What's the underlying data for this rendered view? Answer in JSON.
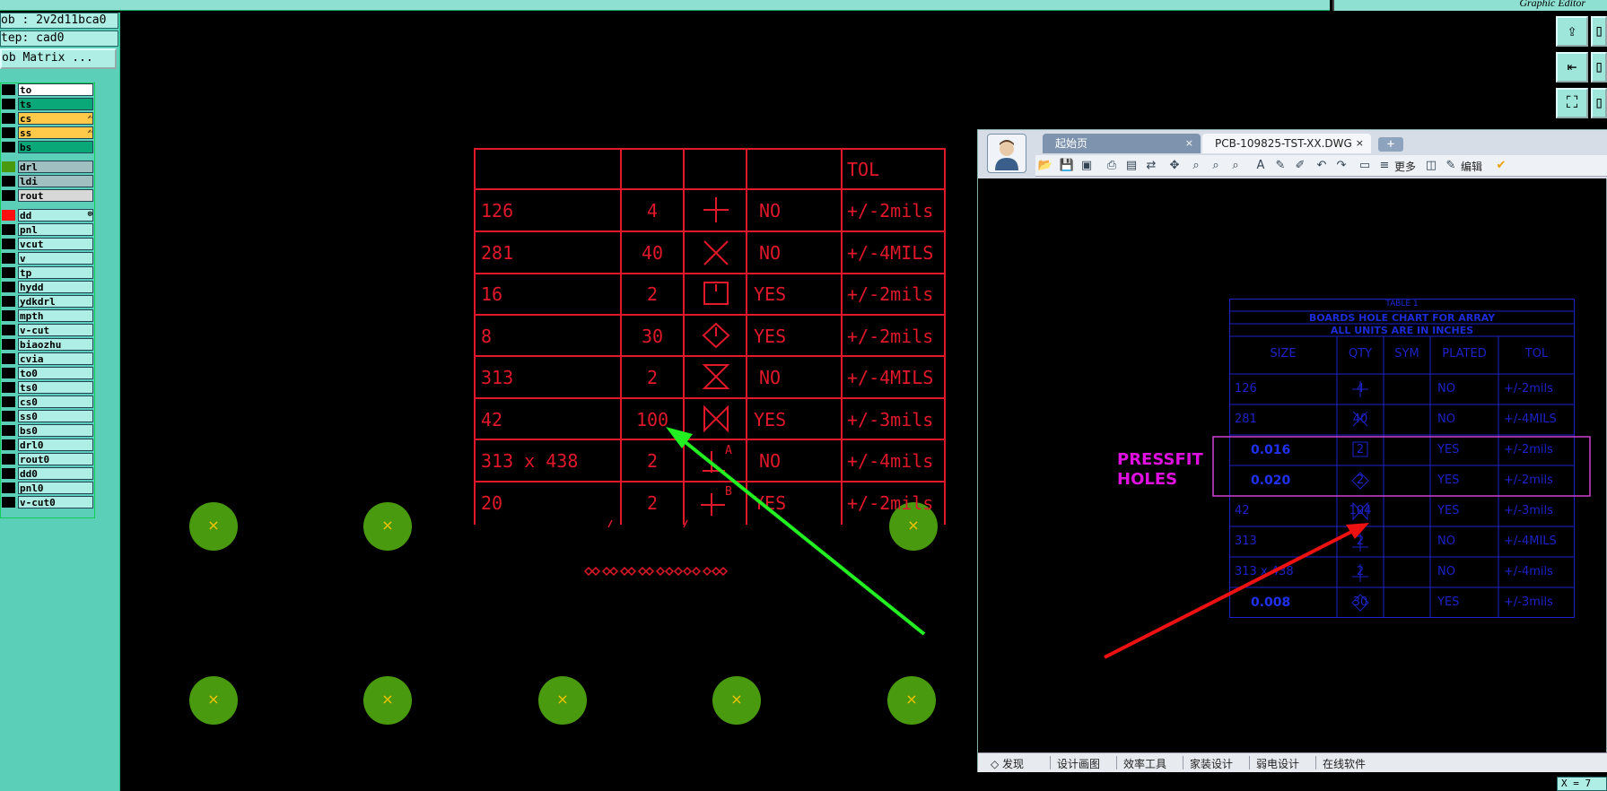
{
  "window": {
    "title": "Graphic Editor"
  },
  "info": {
    "job": "ob : 2v2d11bca0",
    "step": "tep: cad0",
    "matrix_button": "ob Matrix ..."
  },
  "layers": [
    {
      "name": "to",
      "color": "#ffffff",
      "swatch": "#000000"
    },
    {
      "name": "ts",
      "color": "#0aa878",
      "swatch": "#000000"
    },
    {
      "name": "cs",
      "color": "#ffc94a",
      "swatch": "#000000",
      "mark": "✍"
    },
    {
      "name": "ss",
      "color": "#ffc94a",
      "swatch": "#000000",
      "mark": "✍"
    },
    {
      "name": "bs",
      "color": "#0aa878",
      "swatch": "#000000"
    },
    {
      "name": "drl",
      "color": "#9fbfc0",
      "swatch": "#4a9a10"
    },
    {
      "name": "ldi",
      "color": "#9fbfc0",
      "swatch": "#000000"
    },
    {
      "name": "rout",
      "color": "#d8d8d8",
      "swatch": "#000000"
    },
    {
      "name": "dd",
      "color": "#aeeee4",
      "swatch": "#ff1010",
      "mark": "⊗"
    },
    {
      "name": "pnl",
      "color": "#aeeee4",
      "swatch": "#000000"
    },
    {
      "name": "vcut",
      "color": "#aeeee4",
      "swatch": "#000000"
    },
    {
      "name": "v",
      "color": "#aeeee4",
      "swatch": "#000000"
    },
    {
      "name": "tp",
      "color": "#aeeee4",
      "swatch": "#000000"
    },
    {
      "name": "hydd",
      "color": "#aeeee4",
      "swatch": "#000000"
    },
    {
      "name": "ydkdrl",
      "color": "#aeeee4",
      "swatch": "#000000"
    },
    {
      "name": "mpth",
      "color": "#aeeee4",
      "swatch": "#000000"
    },
    {
      "name": "v-cut",
      "color": "#aeeee4",
      "swatch": "#000000"
    },
    {
      "name": "biaozhu",
      "color": "#aeeee4",
      "swatch": "#000000"
    },
    {
      "name": "cvia",
      "color": "#aeeee4",
      "swatch": "#000000"
    },
    {
      "name": "to0",
      "color": "#aeeee4",
      "swatch": "#000000"
    },
    {
      "name": "ts0",
      "color": "#aeeee4",
      "swatch": "#000000"
    },
    {
      "name": "cs0",
      "color": "#aeeee4",
      "swatch": "#000000"
    },
    {
      "name": "ss0",
      "color": "#aeeee4",
      "swatch": "#000000"
    },
    {
      "name": "bs0",
      "color": "#aeeee4",
      "swatch": "#000000"
    },
    {
      "name": "drl0",
      "color": "#aeeee4",
      "swatch": "#000000"
    },
    {
      "name": "rout0",
      "color": "#aeeee4",
      "swatch": "#000000"
    },
    {
      "name": "dd0",
      "color": "#aeeee4",
      "swatch": "#000000"
    },
    {
      "name": "pnl0",
      "color": "#aeeee4",
      "swatch": "#000000"
    },
    {
      "name": "v-cut0",
      "color": "#aeeee4",
      "swatch": "#000000"
    }
  ],
  "red_table": {
    "header_tol": "TOL",
    "rows": [
      {
        "size": "126",
        "qty": "4",
        "plated": "NO",
        "tol": "+/-2mils"
      },
      {
        "size": "281",
        "qty": "40",
        "plated": "NO",
        "tol": "+/-4MILS"
      },
      {
        "size": "16",
        "qty": "2",
        "plated": "YES",
        "tol": "+/-2mils"
      },
      {
        "size": "8",
        "qty": "30",
        "plated": "YES",
        "tol": "+/-2mils"
      },
      {
        "size": "313",
        "qty": "2",
        "plated": "NO",
        "tol": "+/-4MILS"
      },
      {
        "size": "42",
        "qty": "100",
        "plated": "YES",
        "tol": "+/-3mils"
      },
      {
        "size": "313 x 438",
        "qty": "2",
        "plated": "NO",
        "tol": "+/-4mils"
      },
      {
        "size": "20",
        "qty": "2",
        "plated": "YES",
        "tol": "+/-2mils"
      }
    ],
    "sym_labels": {
      "a": "A",
      "b": "B"
    }
  },
  "cad_viewer": {
    "tab_home": "起始页",
    "tab_file": "PCB-109825-TST-XX.DWG",
    "tab_close": "×",
    "tab_add": "+",
    "toolbar_more": "更多",
    "toolbar_edit": "编辑",
    "bottom_items": [
      "◇ 发现",
      "设计画图",
      "效率工具",
      "家装设计",
      "弱电设计",
      "在线软件"
    ],
    "pressfit_label": [
      "PRESSFIT",
      "HOLES"
    ],
    "blue_table": {
      "title_lines": [
        "TABLE 1",
        "BOARDS HOLE CHART FOR ARRAY",
        "ALL UNITS ARE IN INCHES"
      ],
      "headers": [
        "SIZE",
        "QTY",
        "SYM",
        "PLATED",
        "TOL"
      ],
      "rows": [
        {
          "size": "126",
          "qty": "4",
          "plated": "NO",
          "tol": "+/-2mils",
          "bold": false
        },
        {
          "size": "281",
          "qty": "40",
          "plated": "NO",
          "tol": "+/-4MILS",
          "bold": false
        },
        {
          "size": "0.016",
          "qty": "2",
          "plated": "YES",
          "tol": "+/-2mils",
          "bold": true
        },
        {
          "size": "0.020",
          "qty": "2",
          "plated": "YES",
          "tol": "+/-2mils",
          "bold": true
        },
        {
          "size": "42",
          "qty": "104",
          "plated": "YES",
          "tol": "+/-3mils",
          "bold": false
        },
        {
          "size": "313",
          "qty": "2",
          "plated": "NO",
          "tol": "+/-4MILS",
          "bold": false
        },
        {
          "size": "313 x 438",
          "qty": "2",
          "plated": "NO",
          "tol": "+/-4mils",
          "bold": false
        },
        {
          "size": "0.008",
          "qty": "30",
          "plated": "YES",
          "tol": "+/-3mils",
          "bold": true
        }
      ]
    }
  },
  "status": {
    "coord": "X = 7"
  },
  "colors": {
    "accent_teal": "#5ccfb9",
    "red_table": "#e0182a",
    "green_arrow": "#22ee22",
    "red_arrow": "#ee1111",
    "pad_green": "#4a9a10"
  }
}
